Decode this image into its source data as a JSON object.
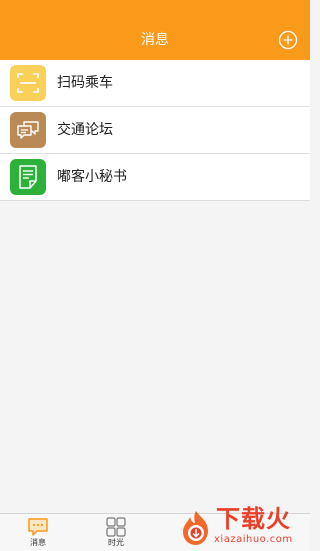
{
  "header": {
    "title": "消息",
    "add_icon": "plus-circle-icon"
  },
  "list": {
    "items": [
      {
        "label": "扫码乘车",
        "icon": "scan-qr-icon",
        "icon_color": "#f9d15a"
      },
      {
        "label": "交通论坛",
        "icon": "chat-bubbles-icon",
        "icon_color": "#b98a56"
      },
      {
        "label": "嘟客小秘书",
        "icon": "document-icon",
        "icon_color": "#2eb13a"
      }
    ]
  },
  "tabbar": {
    "tabs": [
      {
        "label": "消息",
        "icon": "message-icon",
        "active": true
      },
      {
        "label": "时光",
        "icon": "grid-icon",
        "active": false
      }
    ]
  },
  "watermark": {
    "text": "下载火",
    "sub": "xiazaihuo.com",
    "icon": "fire-logo-icon"
  },
  "colors": {
    "header_bg": "#f99a1a",
    "accent": "#f99a1a",
    "watermark": "#e8402a"
  }
}
